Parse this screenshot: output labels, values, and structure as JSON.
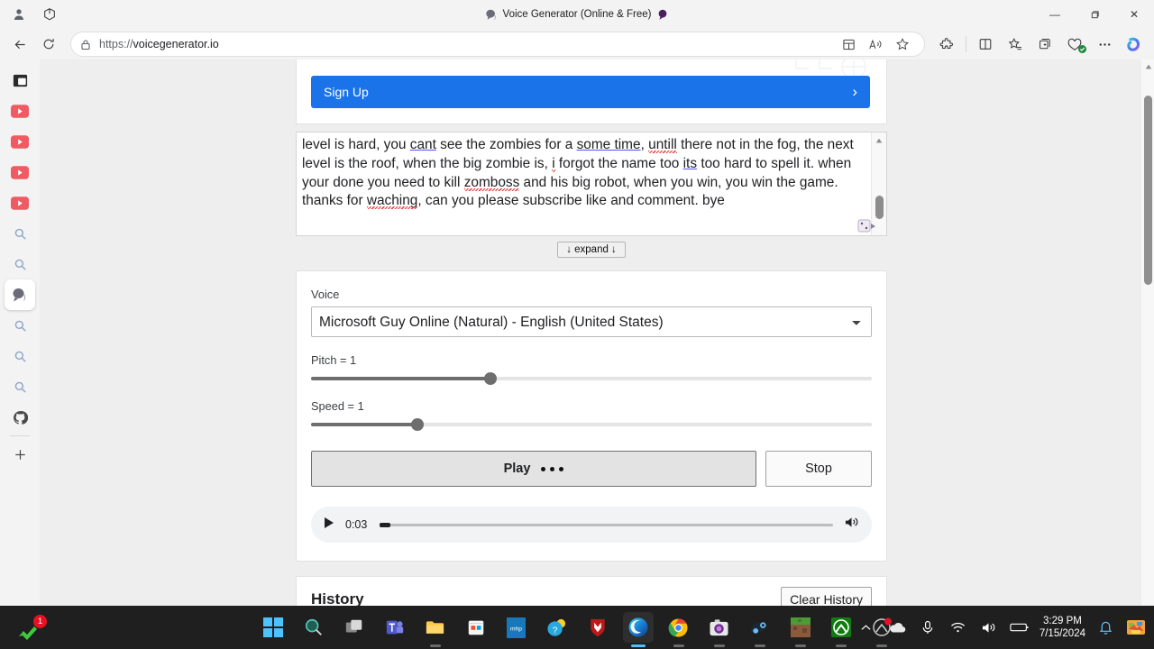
{
  "browser": {
    "tab_title": "Voice Generator (Online & Free)",
    "url_prefix": "https://",
    "url_bold": "voicegenerator.io",
    "url_full": "https://voicegenerator.io",
    "window_controls": {
      "minimize": "—",
      "restore": "❐",
      "close": "✕"
    }
  },
  "page": {
    "signup": {
      "label": "Sign Up",
      "chevron": "›"
    },
    "textarea": {
      "text": "level is hard, you cant see the zombies for a some time, untill there not in the fog, the next level is the roof, when the big zombie is, i forgot the name too its too hard to spell it. when your done you need to kill zomboss and his big robot, when you win, you win the game. thanks for waching, can you please subscribe like and comment. bye",
      "line1_a": "level is hard, you ",
      "line1_b": "cant",
      "line1_c": " see the zombies for a ",
      "line1_d": "some time",
      "line1_e": ", ",
      "line1_f": "untill",
      "line1_g": " there not in the",
      "line2_a": "fog, the next level is the roof, when the big zombie is, ",
      "line2_b": "i",
      "line2_c": " forgot the name too ",
      "line2_d": "its",
      "line3_a": "too hard to spell it. when your done you need to kill ",
      "line3_b": "zomboss",
      "line3_c": " and his big robot,",
      "line4_a": "when you win, you win the game. thanks for ",
      "line4_b": "waching",
      "line4_c": ", can you please",
      "line5": "subscribe like and comment. bye"
    },
    "expand_label": "↓ expand ↓",
    "voice": {
      "label": "Voice",
      "selected": "Microsoft Guy Online (Natural) - English (United States)",
      "options": [
        "Microsoft Guy Online (Natural) - English (United States)"
      ]
    },
    "pitch": {
      "label": "Pitch = 1",
      "value": 1,
      "percent": 32
    },
    "speed": {
      "label": "Speed = 1",
      "value": 1,
      "percent": 19
    },
    "play_label": "Play",
    "stop_label": "Stop",
    "audio": {
      "time": "0:03",
      "progress_percent": 2
    },
    "history": {
      "title": "History",
      "clear_label": "Clear History"
    }
  },
  "taskbar": {
    "time": "3:29 PM",
    "date": "7/15/2024",
    "badge_count": "1"
  },
  "colors": {
    "accent_blue": "#1a73e8",
    "taskbar_bg": "#1f1f1f",
    "slider_fill": "#6e6e6e",
    "youtube_red": "#f05a63"
  }
}
